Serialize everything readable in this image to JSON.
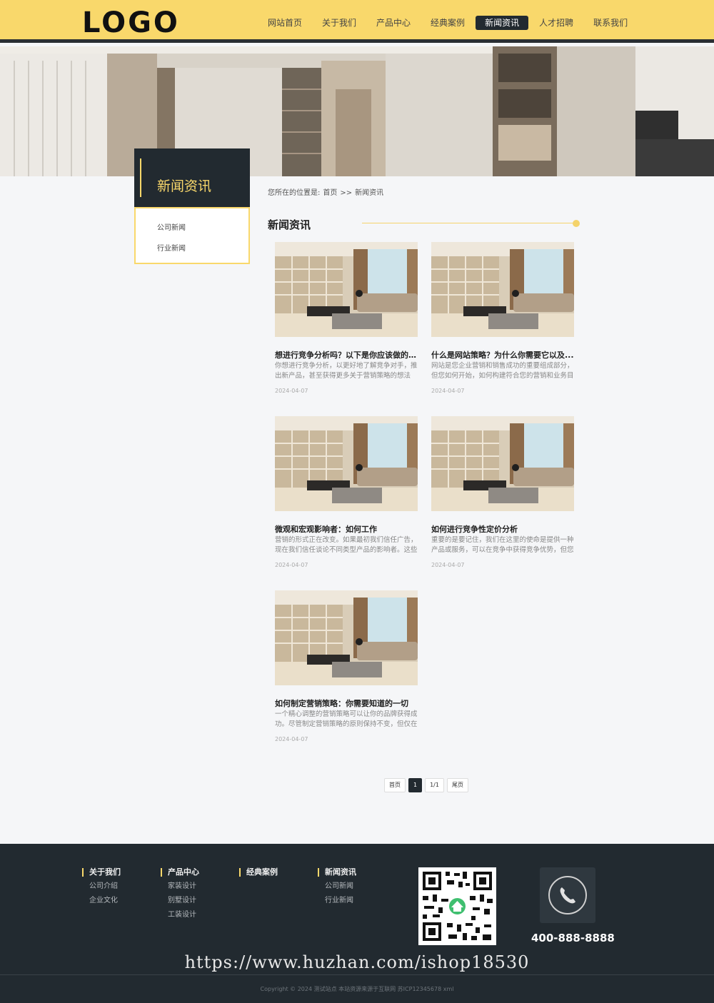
{
  "header": {
    "logo": "LOGO",
    "nav": [
      {
        "label": "网站首页",
        "active": false
      },
      {
        "label": "关于我们",
        "active": false
      },
      {
        "label": "产品中心",
        "active": false
      },
      {
        "label": "经典案例",
        "active": false
      },
      {
        "label": "新闻资讯",
        "active": true
      },
      {
        "label": "人才招聘",
        "active": false
      },
      {
        "label": "联系我们",
        "active": false
      }
    ]
  },
  "colors": {
    "accent": "#f9d86b",
    "dark": "#222a30"
  },
  "sidebar": {
    "title": "新闻资讯",
    "items": [
      "公司新闻",
      "行业新闻"
    ]
  },
  "breadcrumb": {
    "prefix": "您所在的位置是:",
    "home": "首页",
    "sep": ">>",
    "current": "新闻资讯"
  },
  "section": {
    "title": "新闻资讯"
  },
  "articles": [
    {
      "title": "想进行竞争分析吗？以下是你应该做的7...",
      "desc": "你想进行竞争分析，以更好地了解竞争对手，推出新产品，甚至获得更多关于营销策略的想法",
      "date": "2024-04-07"
    },
    {
      "title": "什么是网站策略？为什么你需要它以及...",
      "desc": "网站是您企业营销和销售成功的重要组成部分，但您如何开始，如何构建符合您的营销和业务目",
      "date": "2024-04-07"
    },
    {
      "title": "微观和宏观影响者：如何工作",
      "desc": "营销的形式正在改变。如果最初我们信任广告，现在我们信任谈论不同类型产品的影响者。这些",
      "date": "2024-04-07"
    },
    {
      "title": "如何进行竞争性定价分析",
      "desc": "重要的是要记住，我们在这里的使命是提供一种产品或服务，可以在竞争中获得竞争优势，但您",
      "date": "2024-04-07"
    },
    {
      "title": "如何制定营销策略：你需要知道的一切",
      "desc": "一个精心调整的营销策略可以让你的品牌获得成功。尽管制定营销策略的原则保持不变，但仅在",
      "date": "2024-04-07"
    }
  ],
  "pagination": {
    "first": "首页",
    "current": "1",
    "count": "1/1",
    "last": "尾页"
  },
  "footer": {
    "columns": [
      {
        "title": "关于我们",
        "links": [
          "公司介绍",
          "企业文化"
        ]
      },
      {
        "title": "产品中心",
        "links": [
          "家装设计",
          "别墅设计",
          "工装设计"
        ]
      },
      {
        "title": "经典案例",
        "links": []
      },
      {
        "title": "新闻资讯",
        "links": [
          "公司新闻",
          "行业新闻"
        ]
      }
    ],
    "phone": "400-888-8888",
    "watermark": "https://www.huzhan.com/ishop18530",
    "copyright": "Copyright © 2024 测试站点 本站资源来源于互联网 苏ICP12345678 xml"
  }
}
